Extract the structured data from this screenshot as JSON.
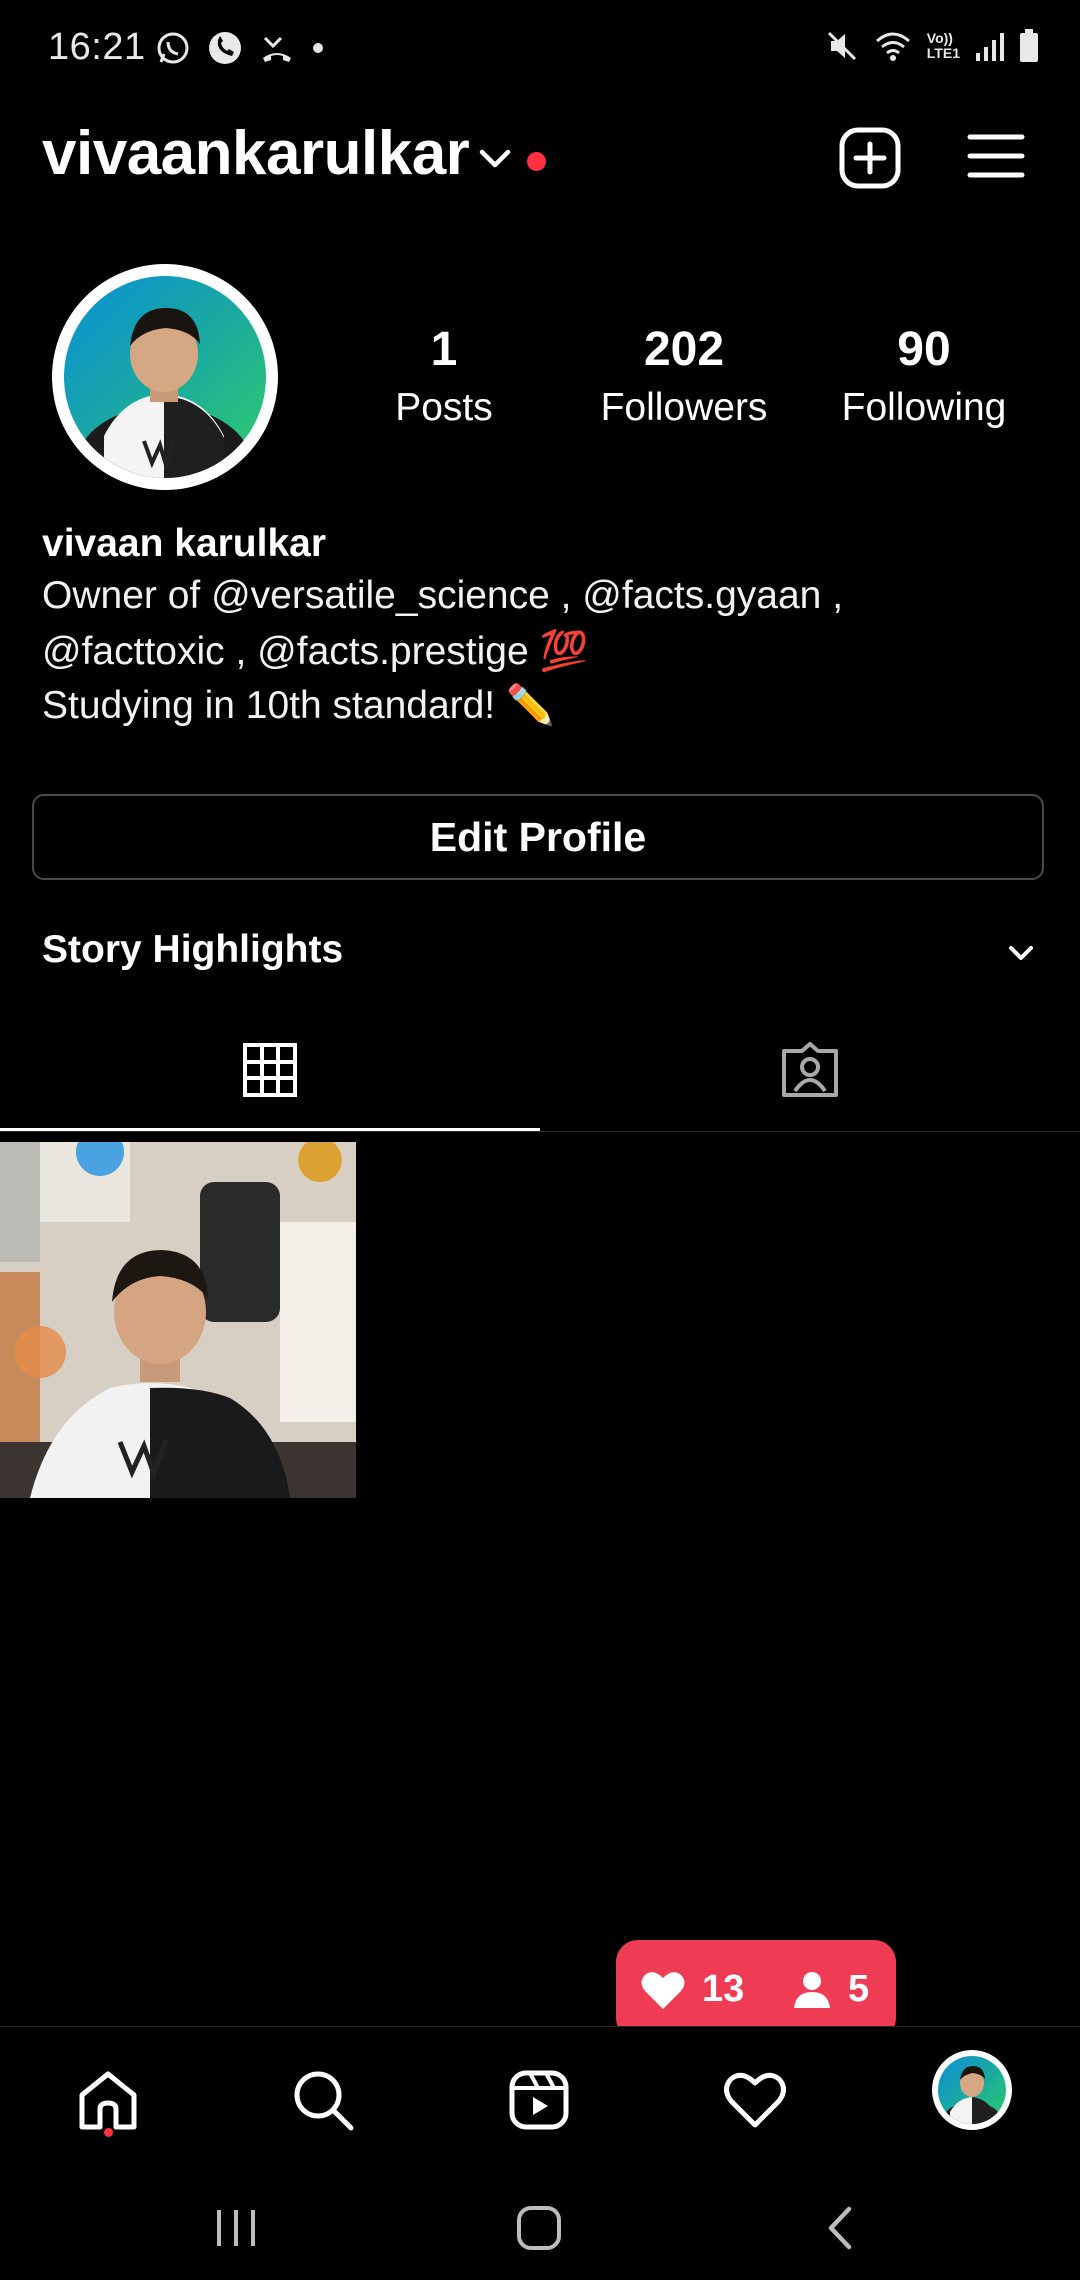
{
  "status_bar": {
    "time": "16:21",
    "network_label_top": "Vo))",
    "network_label_bottom": "LTE1"
  },
  "header": {
    "username": "vivaankarulkar"
  },
  "profile": {
    "stats": [
      {
        "value": "1",
        "label": "Posts"
      },
      {
        "value": "202",
        "label": "Followers"
      },
      {
        "value": "90",
        "label": "Following"
      }
    ],
    "full_name": "vivaan karulkar",
    "bio_lines": [
      "Owner of @versatile_science , @facts.gyaan ,",
      "@facttoxic , @facts.prestige 💯",
      "Studying in 10th standard! ✏️"
    ]
  },
  "edit_profile_label": "Edit Profile",
  "story_highlights_label": "Story Highlights",
  "tabs": [
    {
      "icon": "grid-icon",
      "active": true
    },
    {
      "icon": "tagged-icon",
      "active": false
    }
  ],
  "notification": {
    "likes": "13",
    "followers": "5",
    "color": "#ef3b53"
  },
  "bottom_nav": [
    "home-icon",
    "search-icon",
    "reels-icon",
    "heart-icon",
    "profile-avatar"
  ],
  "accent_red": "#ff3040"
}
